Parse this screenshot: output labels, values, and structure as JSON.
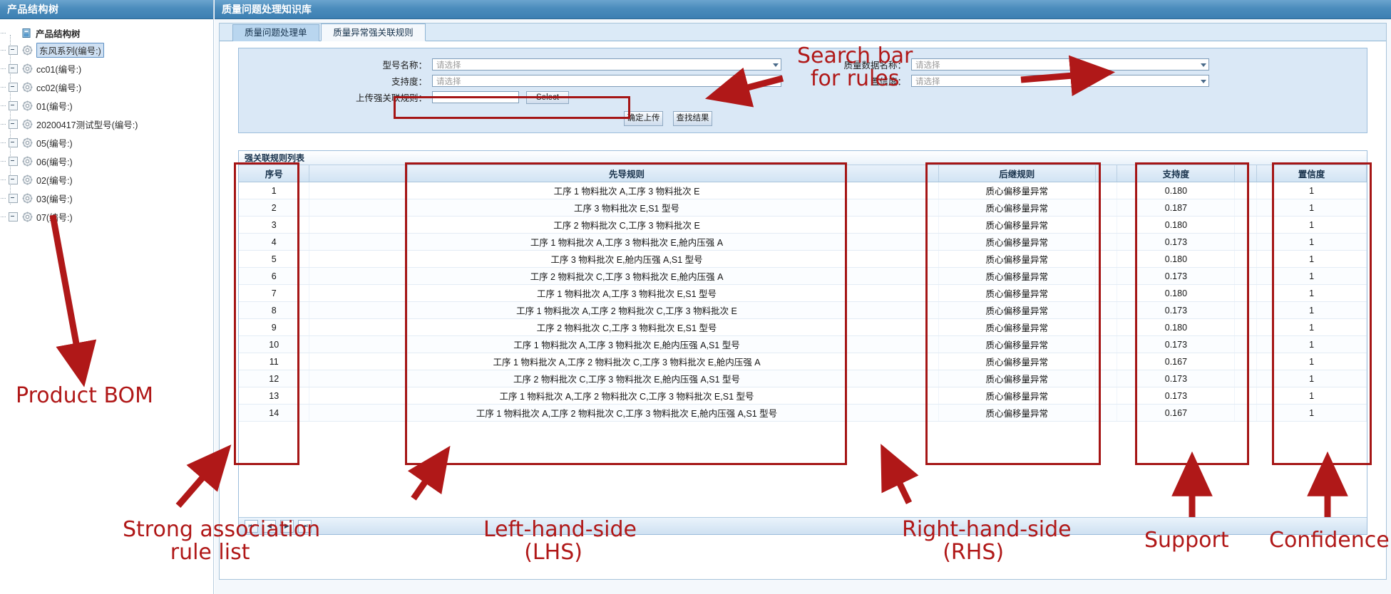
{
  "tree_panel": {
    "header": "产品结构树",
    "root_label": "产品结构树",
    "items": [
      {
        "label": "东风系列(编号:)",
        "selected": true
      },
      {
        "label": "cc01(编号:)",
        "selected": false
      },
      {
        "label": "cc02(编号:)",
        "selected": false
      },
      {
        "label": "01(编号:)",
        "selected": false
      },
      {
        "label": "20200417测试型号(编号:)",
        "selected": false
      },
      {
        "label": "05(编号:)",
        "selected": false
      },
      {
        "label": "06(编号:)",
        "selected": false
      },
      {
        "label": "02(编号:)",
        "selected": false
      },
      {
        "label": "03(编号:)",
        "selected": false
      },
      {
        "label": "07(编号:)",
        "selected": false
      }
    ]
  },
  "main": {
    "header": "质量问题处理知识库",
    "tabs": [
      {
        "label": "质量问题处理单",
        "active": false
      },
      {
        "label": "质量异常强关联规则",
        "active": true
      }
    ]
  },
  "search_form": {
    "model_name_label": "型号名称：",
    "model_name_value": "请选择",
    "support_label": "支持度：",
    "support_value": "请选择",
    "upload_label": "上传强关联规则：",
    "upload_value": "",
    "select_button": "Select",
    "data_name_label": "质量数据名称：",
    "data_name_value": "请选择",
    "confidence_label": "置信度：",
    "confidence_value": "请选择",
    "confirm_upload_button": "确定上传",
    "search_result_button": "查找结果"
  },
  "grid": {
    "title": "强关联规则列表",
    "columns": [
      "序号",
      "先导规则",
      "后继规则",
      "支持度",
      "置信度"
    ],
    "rows": [
      {
        "seq": "1",
        "lhs": "工序 1 物料批次 A,工序 3 物料批次 E",
        "rhs": "质心偏移量异常",
        "support": "0.180",
        "confidence": "1"
      },
      {
        "seq": "2",
        "lhs": "工序 3 物料批次 E,S1 型号",
        "rhs": "质心偏移量异常",
        "support": "0.187",
        "confidence": "1"
      },
      {
        "seq": "3",
        "lhs": "工序 2 物料批次 C,工序 3 物料批次 E",
        "rhs": "质心偏移量异常",
        "support": "0.180",
        "confidence": "1"
      },
      {
        "seq": "4",
        "lhs": "工序 1 物料批次 A,工序 3 物料批次 E,舱内压强 A",
        "rhs": "质心偏移量异常",
        "support": "0.173",
        "confidence": "1"
      },
      {
        "seq": "5",
        "lhs": "工序 3 物料批次 E,舱内压强 A,S1 型号",
        "rhs": "质心偏移量异常",
        "support": "0.180",
        "confidence": "1"
      },
      {
        "seq": "6",
        "lhs": "工序 2 物料批次 C,工序 3 物料批次 E,舱内压强 A",
        "rhs": "质心偏移量异常",
        "support": "0.173",
        "confidence": "1"
      },
      {
        "seq": "7",
        "lhs": "工序 1 物料批次 A,工序 3 物料批次 E,S1 型号",
        "rhs": "质心偏移量异常",
        "support": "0.180",
        "confidence": "1"
      },
      {
        "seq": "8",
        "lhs": "工序 1 物料批次 A,工序 2 物料批次 C,工序 3 物料批次 E",
        "rhs": "质心偏移量异常",
        "support": "0.173",
        "confidence": "1"
      },
      {
        "seq": "9",
        "lhs": "工序 2 物料批次 C,工序 3 物料批次 E,S1 型号",
        "rhs": "质心偏移量异常",
        "support": "0.180",
        "confidence": "1"
      },
      {
        "seq": "10",
        "lhs": "工序 1 物料批次 A,工序 3 物料批次 E,舱内压强 A,S1 型号",
        "rhs": "质心偏移量异常",
        "support": "0.173",
        "confidence": "1"
      },
      {
        "seq": "11",
        "lhs": "工序 1 物料批次 A,工序 2 物料批次 C,工序 3 物料批次 E,舱内压强 A",
        "rhs": "质心偏移量异常",
        "support": "0.167",
        "confidence": "1"
      },
      {
        "seq": "12",
        "lhs": "工序 2 物料批次 C,工序 3 物料批次 E,舱内压强 A,S1 型号",
        "rhs": "质心偏移量异常",
        "support": "0.173",
        "confidence": "1"
      },
      {
        "seq": "13",
        "lhs": "工序 1 物料批次 A,工序 2 物料批次 C,工序 3 物料批次 E,S1 型号",
        "rhs": "质心偏移量异常",
        "support": "0.173",
        "confidence": "1"
      },
      {
        "seq": "14",
        "lhs": "工序 1 物料批次 A,工序 2 物料批次 C,工序 3 物料批次 E,舱内压强 A,S1 型号",
        "rhs": "质心偏移量异常",
        "support": "0.167",
        "confidence": "1"
      }
    ],
    "pager": {
      "first": "⏮",
      "prev": "◀",
      "next": "▶",
      "last": "⏭"
    }
  },
  "annotations": {
    "color": "#b01818",
    "search_bar": "Search bar\nfor rules",
    "product_bom": "Product BOM",
    "strong_assoc": "Strong association\n       rule list",
    "lhs": "Left-hand-side\n      (LHS)",
    "rhs": "Right-hand-side\n      (RHS)",
    "support": "Support",
    "confidence": "Confidence"
  }
}
